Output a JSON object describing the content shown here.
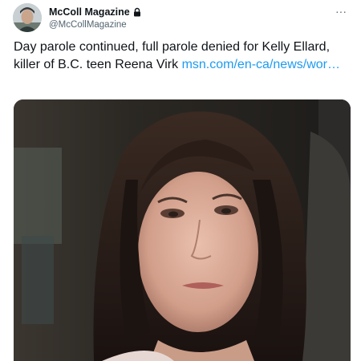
{
  "tweet": {
    "display_name": "McColl Magazine",
    "handle": "@McCollMagazine",
    "more_label": "···",
    "text": "Day parole continued, full parole denied for Kelly Ellard, killer of B.C. teen Reena Virk ",
    "link_text": "msn.com/en-ca/news/wor…"
  },
  "icons": {
    "avatar": "avatar",
    "lock": "lock-icon",
    "more": "more-icon"
  },
  "colors": {
    "text": "#0f1419",
    "secondary": "#536471",
    "link": "#1d9bf0"
  }
}
